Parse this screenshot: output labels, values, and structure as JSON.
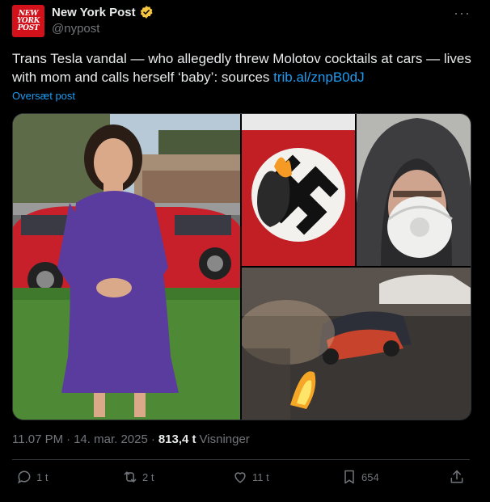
{
  "account": {
    "display_name": "New York Post",
    "handle": "@nypost",
    "avatar_lines": [
      "NEW",
      "YORK",
      "POST"
    ],
    "verified_color": "#f4c542"
  },
  "post": {
    "text": "Trans Tesla vandal — who allegedly threw Molotov cocktails at cars — lives with mom and calls herself ‘baby’: sources ",
    "link": "trib.al/znpB0dJ",
    "translate_label": "Oversæt post"
  },
  "meta": {
    "time": "11.07 PM",
    "separator": "·",
    "date": "14. mar. 2025",
    "views_count": "813,4 t",
    "views_label": "Visninger"
  },
  "actions": {
    "reply_count": "1 t",
    "repost_count": "2 t",
    "like_count": "11 t",
    "bookmark_count": "654"
  },
  "media": {
    "images": [
      "person-in-purple-dress-photo",
      "burning-swastika-flag-photo",
      "masked-person-photo",
      "burning-car-night-photo"
    ]
  },
  "colors": {
    "background": "#000000",
    "text": "#e7e9ea",
    "muted": "#71767b",
    "link": "#1d9bf0",
    "brand_red": "#d2111a"
  }
}
